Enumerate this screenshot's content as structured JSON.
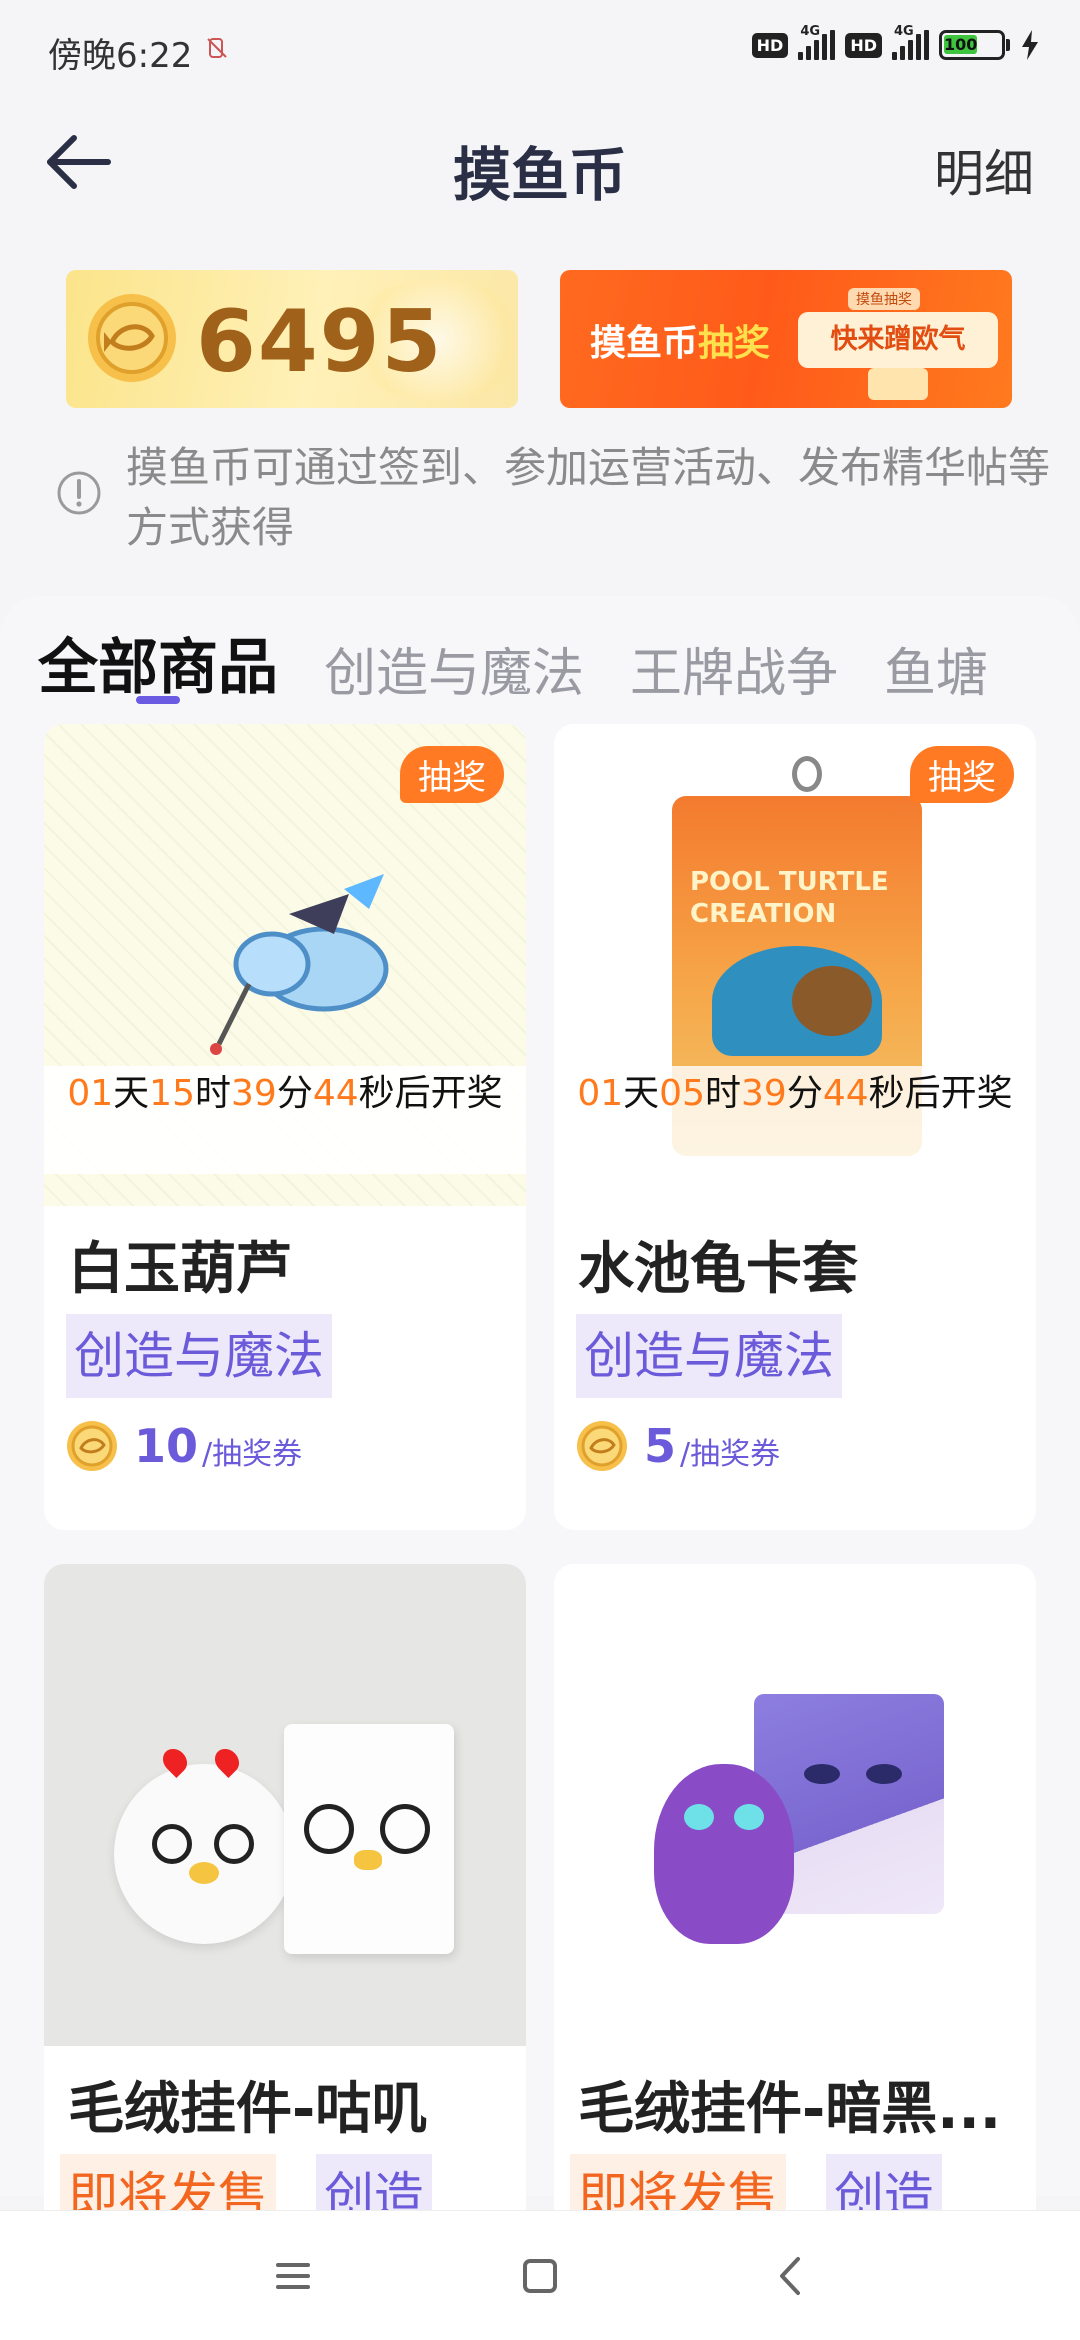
{
  "status_bar": {
    "time": "傍晚6:22",
    "network_label": "4G",
    "hd_label": "HD",
    "battery": "100"
  },
  "header": {
    "title": "摸鱼币",
    "detail_link": "明细"
  },
  "balance": {
    "amount": "6495"
  },
  "lottery_banner": {
    "text_prefix": "摸鱼币",
    "text_highlight": "抽奖",
    "small_label": "摸鱼抽奖",
    "cta": "快来蹭欧气"
  },
  "info": {
    "text": "摸鱼币可通过签到、参加运营活动、发布精华帖等方式获得"
  },
  "tabs": [
    {
      "label": "全部商品",
      "active": true
    },
    {
      "label": "创造与魔法",
      "active": false
    },
    {
      "label": "王牌战争",
      "active": false
    },
    {
      "label": "鱼塘",
      "active": false
    }
  ],
  "products": [
    {
      "badge": "抽奖",
      "countdown": {
        "d": "01",
        "h": "15",
        "m": "39",
        "s": "44",
        "u_d": "天",
        "u_h": "时",
        "u_m": "分",
        "u_s": "秒后开奖"
      },
      "title": "白玉葫芦",
      "tag": "创造与魔法",
      "price": "10",
      "unit": "/抽奖券"
    },
    {
      "badge": "抽奖",
      "countdown": {
        "d": "01",
        "h": "05",
        "m": "39",
        "s": "44",
        "u_d": "天",
        "u_h": "时",
        "u_m": "分",
        "u_s": "秒后开奖"
      },
      "title": "水池龟卡套",
      "tag": "创造与魔法",
      "price": "5",
      "unit": "/抽奖券",
      "image_text": "POOL TURTLE CREATION"
    },
    {
      "title": "毛绒挂件-咕叽",
      "tag_soon": "即将发售",
      "tag": "创造"
    },
    {
      "title": "毛绒挂件-暗黑...",
      "tag_soon": "即将发售",
      "tag": "创造"
    }
  ],
  "colors": {
    "accent": "#6b5ad9",
    "orange": "#ff7a22",
    "coin": "#a0621a"
  }
}
